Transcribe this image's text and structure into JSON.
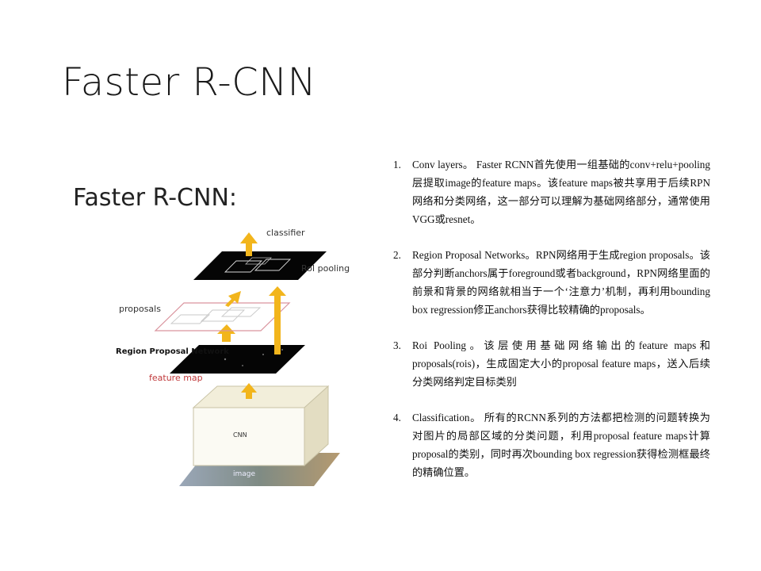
{
  "slide": {
    "title": "Faster R-CNN"
  },
  "figure": {
    "heading": "Faster R-CNN:",
    "labels": {
      "classifier": "classifier",
      "roi_pooling": "RoI pooling",
      "proposals": "proposals",
      "rpn": "Region Proposal Network",
      "feature_map": "feature map",
      "cnn": "CNN",
      "image": "image"
    },
    "colors": {
      "arrow": "#f2b51c",
      "label_red": "#c0393b",
      "proposal_frame": "#d9939d"
    }
  },
  "items": [
    {
      "num": "1.",
      "text": "Conv layers。 Faster RCNN首先使用一组基础的conv+relu+pooling层提取image的feature maps。该feature maps被共享用于后续RPN网络和分类网络，这一部分可以理解为基础网络部分，通常使用VGG或resnet。"
    },
    {
      "num": "2.",
      "text": "Region Proposal Networks。RPN网络用于生成region proposals。该部分判断anchors属于foreground或者background，RPN网络里面的前景和背景的网络就相当于一个‘注意力’机制，再利用bounding box regression修正anchors获得比较精确的proposals。"
    },
    {
      "num": "3.",
      "text": "Roi Pooling。该层使用基础网络输出的feature maps和proposals(rois)，生成固定大小的proposal feature maps，送入后续分类网络判定目标类别"
    },
    {
      "num": "4.",
      "text": "Classification。 所有的RCNN系列的方法都把检测的问题转换为对图片的局部区域的分类问题，利用proposal feature maps计算proposal的类别，同时再次bounding box regression获得检测框最终的精确位置。"
    }
  ]
}
